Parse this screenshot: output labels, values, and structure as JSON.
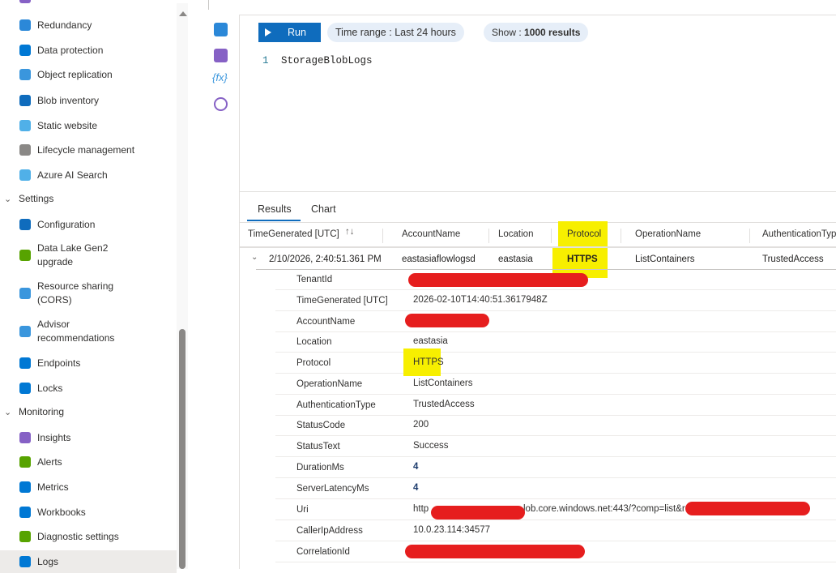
{
  "sidebar": {
    "items": [
      {
        "label": "Redundancy",
        "color": "#2b88d8"
      },
      {
        "label": "Data protection",
        "color": "#0078d4"
      },
      {
        "label": "Object replication",
        "color": "#3a96dd"
      },
      {
        "label": "Blob inventory",
        "color": "#0f6cbd"
      },
      {
        "label": "Static website",
        "color": "#50b0e8"
      },
      {
        "label": "Lifecycle management",
        "color": "#8a8886"
      },
      {
        "label": "Azure AI Search",
        "color": "#50b0e8"
      }
    ],
    "settings_group": "Settings",
    "settings_items": [
      {
        "label": "Configuration",
        "color": "#0f6cbd"
      },
      {
        "label": "Data Lake Gen2",
        "label2": "upgrade",
        "color": "#57a300"
      },
      {
        "label": "Resource sharing",
        "label2": "(CORS)",
        "color": "#3a96dd"
      },
      {
        "label": "Advisor",
        "label2": "recommendations",
        "color": "#3a96dd"
      },
      {
        "label": "Endpoints",
        "color": "#0078d4"
      },
      {
        "label": "Locks",
        "color": "#0078d4"
      }
    ],
    "monitoring_group": "Monitoring",
    "monitoring_items": [
      {
        "label": "Insights",
        "color": "#8661c5"
      },
      {
        "label": "Alerts",
        "color": "#57a300"
      },
      {
        "label": "Metrics",
        "color": "#0078d4"
      },
      {
        "label": "Workbooks",
        "color": "#0078d4"
      },
      {
        "label": "Diagnostic settings",
        "color": "#57a300"
      },
      {
        "label": "Logs",
        "color": "#0078d4"
      }
    ]
  },
  "toolbar": {
    "run": "Run",
    "time_range_label": "Time range :",
    "time_range_value": "Last 24 hours",
    "show_label": "Show :",
    "show_value": "1000 results"
  },
  "editor": {
    "line": "1",
    "query": "StorageBlobLogs"
  },
  "tabs": {
    "results": "Results",
    "chart": "Chart"
  },
  "table": {
    "headers": [
      "TimeGenerated [UTC]",
      "AccountName",
      "Location",
      "Protocol",
      "OperationName",
      "AuthenticationTyp"
    ],
    "sort_icon": "↑↓",
    "row": [
      "2/10/2026, 2:40:51.361 PM",
      "eastasiaflowlogsd",
      "eastasia",
      "HTTPS",
      "ListContainers",
      "TrustedAccess"
    ]
  },
  "details": [
    {
      "key": "TenantId",
      "value": ""
    },
    {
      "key": "TimeGenerated [UTC]",
      "value": "2026-02-10T14:40:51.3617948Z"
    },
    {
      "key": "AccountName",
      "value": ""
    },
    {
      "key": "Location",
      "value": "eastasia"
    },
    {
      "key": "Protocol",
      "value": "HTTPS"
    },
    {
      "key": "OperationName",
      "value": "ListContainers"
    },
    {
      "key": "AuthenticationType",
      "value": "TrustedAccess"
    },
    {
      "key": "StatusCode",
      "value": "200"
    },
    {
      "key": "StatusText",
      "value": "Success"
    },
    {
      "key": "DurationMs",
      "value": "4"
    },
    {
      "key": "ServerLatencyMs",
      "value": "4"
    },
    {
      "key": "Uri",
      "value": "http",
      "value2": "lob.core.windows.net:443/?comp=list&r"
    },
    {
      "key": "CallerIpAddress",
      "value": "10.0.23.114:34577"
    },
    {
      "key": "CorrelationId",
      "value": ""
    }
  ]
}
